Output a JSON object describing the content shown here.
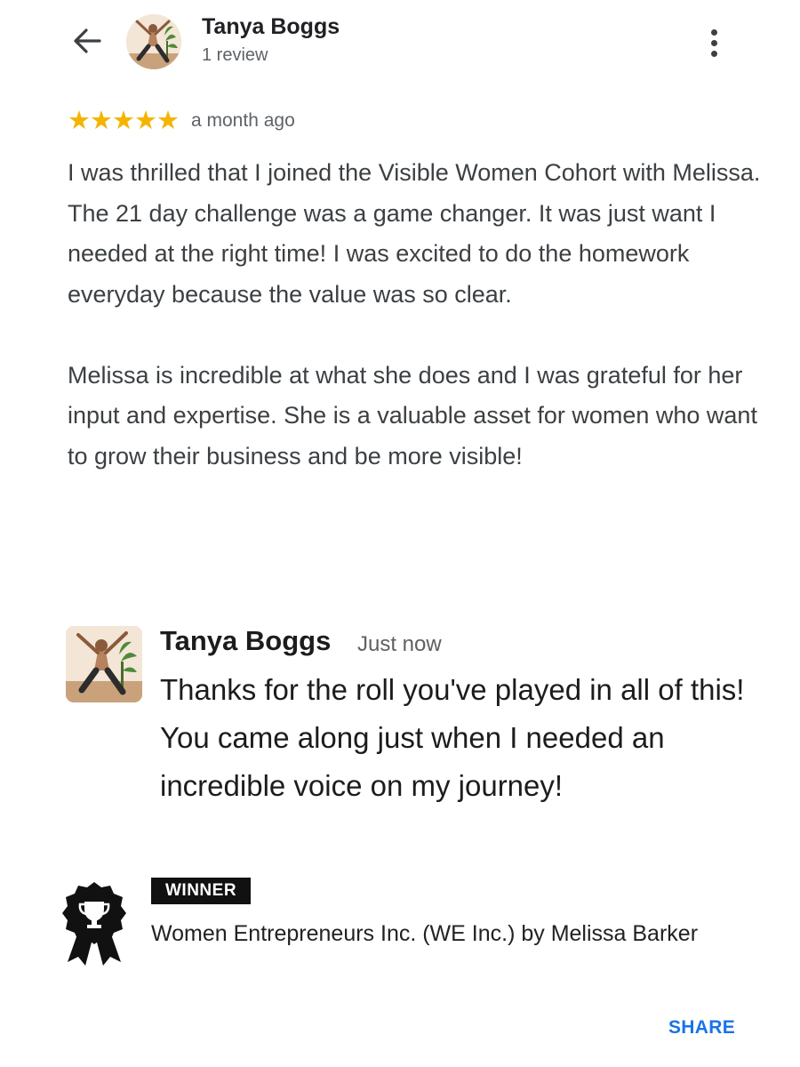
{
  "header": {
    "back_icon": "arrow-left-icon",
    "reviewer_name": "Tanya Boggs",
    "review_count": "1 review",
    "more_icon": "more-vertical-icon"
  },
  "review": {
    "rating": 5,
    "rating_max": 5,
    "stars": "★★★★★",
    "star_color": "#f4b400",
    "date": "a month ago",
    "paragraphs": [
      "I was thrilled that I joined the Visible Women Cohort with Melissa. The 21 day challenge was a game changer. It was just want I needed at the right time! I was excited to do the homework everyday because the value was so clear.",
      "Melissa is incredible at what she does and I was grateful for her input and expertise. She is a valuable asset for women who want to grow their business and be more visible!"
    ]
  },
  "reply": {
    "name": "Tanya Boggs",
    "time": "Just now",
    "text": "Thanks for the roll you've played in all of this! You came along just when I needed an incredible voice on my journey!"
  },
  "award": {
    "icon": "award-ribbon-icon",
    "badge": "WINNER",
    "title": "Women Entrepreneurs Inc. (WE Inc.) by Melissa Barker"
  },
  "actions": {
    "share_label": "SHARE",
    "share_color": "#1a73e8"
  }
}
